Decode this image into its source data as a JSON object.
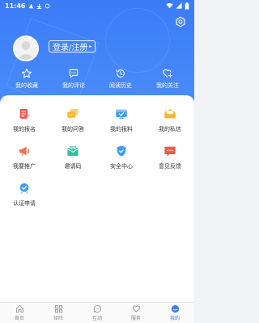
{
  "status_bar": {
    "time": "11:46"
  },
  "profile": {
    "login_label": "登录/注册",
    "login_arrow": "▸"
  },
  "quick_actions": [
    {
      "label": "我的收藏",
      "icon": "star-icon"
    },
    {
      "label": "我的评论",
      "icon": "comment-icon"
    },
    {
      "label": "阅读历史",
      "icon": "history-icon"
    },
    {
      "label": "我的关注",
      "icon": "heart-plus-icon"
    }
  ],
  "grid_items": [
    {
      "label": "我的报名",
      "icon": "signup-icon",
      "color": "#f05a4f"
    },
    {
      "label": "我的问答",
      "icon": "qa-icon",
      "color": "#f5b52d"
    },
    {
      "label": "我的报料",
      "icon": "report-icon",
      "color": "#3d9df5"
    },
    {
      "label": "我的私信",
      "icon": "message-icon",
      "color": "#f5b52d"
    },
    {
      "label": "我要推广",
      "icon": "megaphone-icon",
      "color": "#f0704f"
    },
    {
      "label": "邀请码",
      "icon": "invite-code-icon",
      "color": "#2fc3a0"
    },
    {
      "label": "安全中心",
      "icon": "shield-icon",
      "color": "#3d9df5"
    },
    {
      "label": "意见反馈",
      "icon": "feedback-icon",
      "color": "#f05a4f"
    },
    {
      "label": "认证申请",
      "icon": "certify-icon",
      "color": "#3d9df5"
    }
  ],
  "tabs": [
    {
      "label": "首页",
      "icon": "home-icon"
    },
    {
      "label": "矩阵",
      "icon": "matrix-icon"
    },
    {
      "label": "互动",
      "icon": "interact-icon"
    },
    {
      "label": "服务",
      "icon": "service-icon"
    },
    {
      "label": "我的",
      "icon": "profile-icon",
      "active": true
    }
  ],
  "colors": {
    "primary": "#3b7cf7",
    "tab_active": "#3b7cf7",
    "tab_inactive": "#8a8a8a"
  }
}
